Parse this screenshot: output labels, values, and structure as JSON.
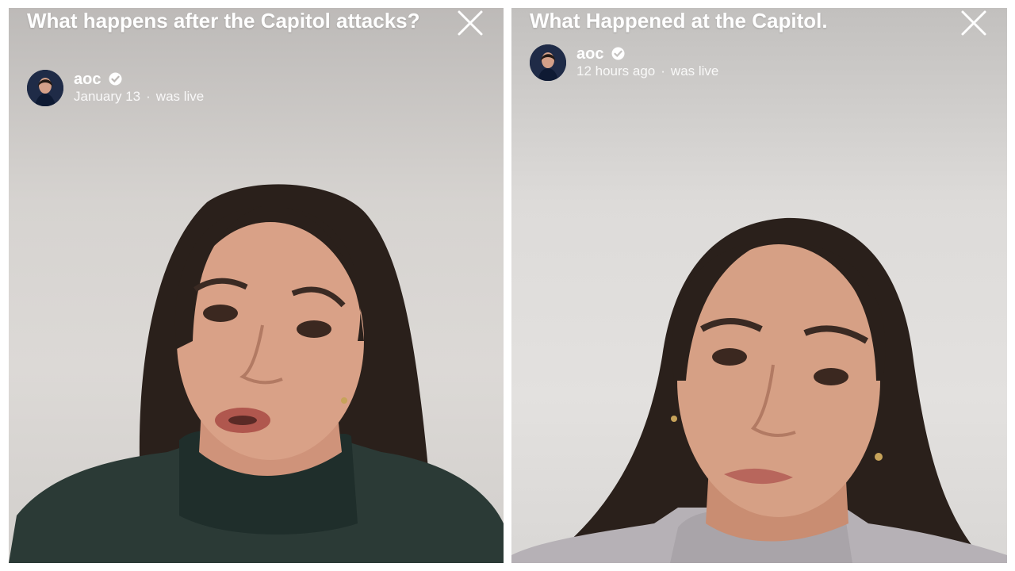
{
  "left": {
    "title": "What happens after the Capitol attacks?",
    "username": "aoc",
    "date": "January 13",
    "separator": "·",
    "status": "was live",
    "icons": {
      "close": "close-icon",
      "verified": "verified-badge-icon"
    }
  },
  "right": {
    "title": "What Happened at the Capitol.",
    "username": "aoc",
    "date": "12 hours ago",
    "separator": "·",
    "status": "was live",
    "icons": {
      "close": "close-icon",
      "verified": "verified-badge-icon"
    }
  },
  "colors": {
    "text": "#ffffff",
    "left_sweater": "#2b3a36",
    "right_sweater": "#b6b1b6",
    "hair": "#2a201b",
    "skin": "#d9a187"
  }
}
